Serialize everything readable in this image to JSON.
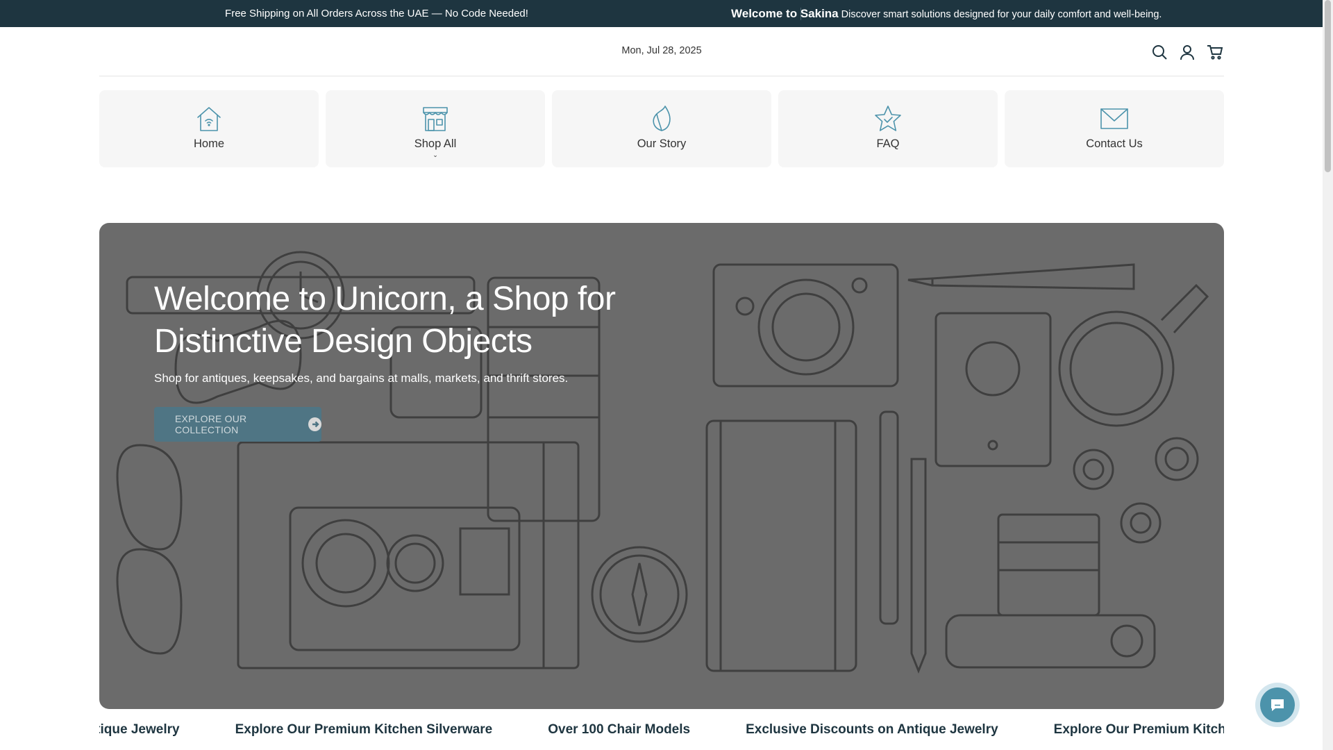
{
  "announcement": {
    "left_text": "Free Shipping on All Orders Across the UAE — No Code Needed!",
    "right_strong": "Welcome to Sakina",
    "right_text": "Discover smart solutions designed for your daily comfort and well-being."
  },
  "header": {
    "date": "Mon, Jul 28, 2025",
    "icons": [
      "search-icon",
      "account-icon",
      "cart-icon"
    ]
  },
  "nav": {
    "items": [
      {
        "label": "Home",
        "icon": "home-icon"
      },
      {
        "label": "Shop All",
        "icon": "store-icon",
        "has_dropdown": true
      },
      {
        "label": "Our Story",
        "icon": "leaf-icon"
      },
      {
        "label": "FAQ",
        "icon": "star-icon"
      },
      {
        "label": "Contact Us",
        "icon": "mail-icon"
      }
    ]
  },
  "hero": {
    "title": "Welcome to Unicorn, a Shop for Distinctive Design Objects",
    "subtitle": "Shop for antiques, keepsakes, and bargains at malls, markets, and thrift stores.",
    "button_label": "EXPLORE OUR COLLECTION"
  },
  "marquee": {
    "items": [
      "Exclusive Discounts on Antique Jewelry",
      "Explore Our Premium Kitchen Silverware",
      "Over 100 Chair Models",
      "Exclusive Discounts on Antique Jewelry",
      "Explore Our Premium Kitchen Silverware"
    ]
  },
  "colors": {
    "announcement_bg": "#1e3540",
    "accent": "#4c93ab",
    "hero_bg": "#6b6b6b",
    "button_bg": "#4f7584"
  }
}
